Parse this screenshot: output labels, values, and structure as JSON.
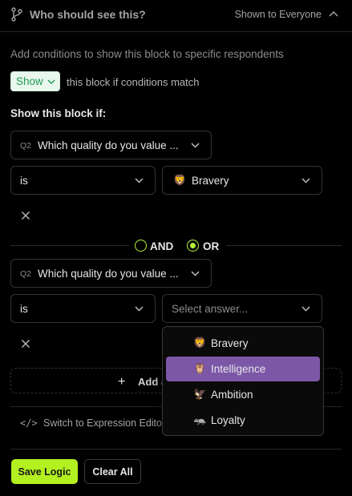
{
  "header": {
    "title": "Who should see this?",
    "visibility": "Shown to Everyone",
    "branch_icon": "git-branch-icon",
    "collapse_icon": "chevron-up-icon"
  },
  "description": "Add conditions to show this block to specific respondents",
  "action": {
    "selected": "Show",
    "suffix": "this block if conditions match"
  },
  "section_label": "Show this block if:",
  "conditions": [
    {
      "question_num": "Q2",
      "question": "Which quality do you value ...",
      "operator": "is",
      "answer_emoji": "🦁",
      "answer": "Bravery"
    },
    {
      "question_num": "Q2",
      "question": "Which quality do you value ...",
      "operator": "is",
      "answer_placeholder": "Select answer..."
    }
  ],
  "logic": {
    "and_label": "AND",
    "or_label": "OR",
    "selected": "OR"
  },
  "add_condition_label": "Add a",
  "expression_editor": {
    "icon": "</>",
    "label": "Switch to Expression Editor"
  },
  "buttons": {
    "save": "Save Logic",
    "clear": "Clear All"
  },
  "answer_options": [
    {
      "emoji": "🦁",
      "label": "Bravery"
    },
    {
      "emoji": "🦉",
      "label": "Intelligence"
    },
    {
      "emoji": "🦅",
      "label": "Ambition"
    },
    {
      "emoji": "🦡",
      "label": "Loyalty"
    }
  ],
  "highlighted_option": "Intelligence",
  "colors": {
    "accent": "#b2f020",
    "show_text": "#1f9d55",
    "menu_highlight": "#7c57a8"
  }
}
